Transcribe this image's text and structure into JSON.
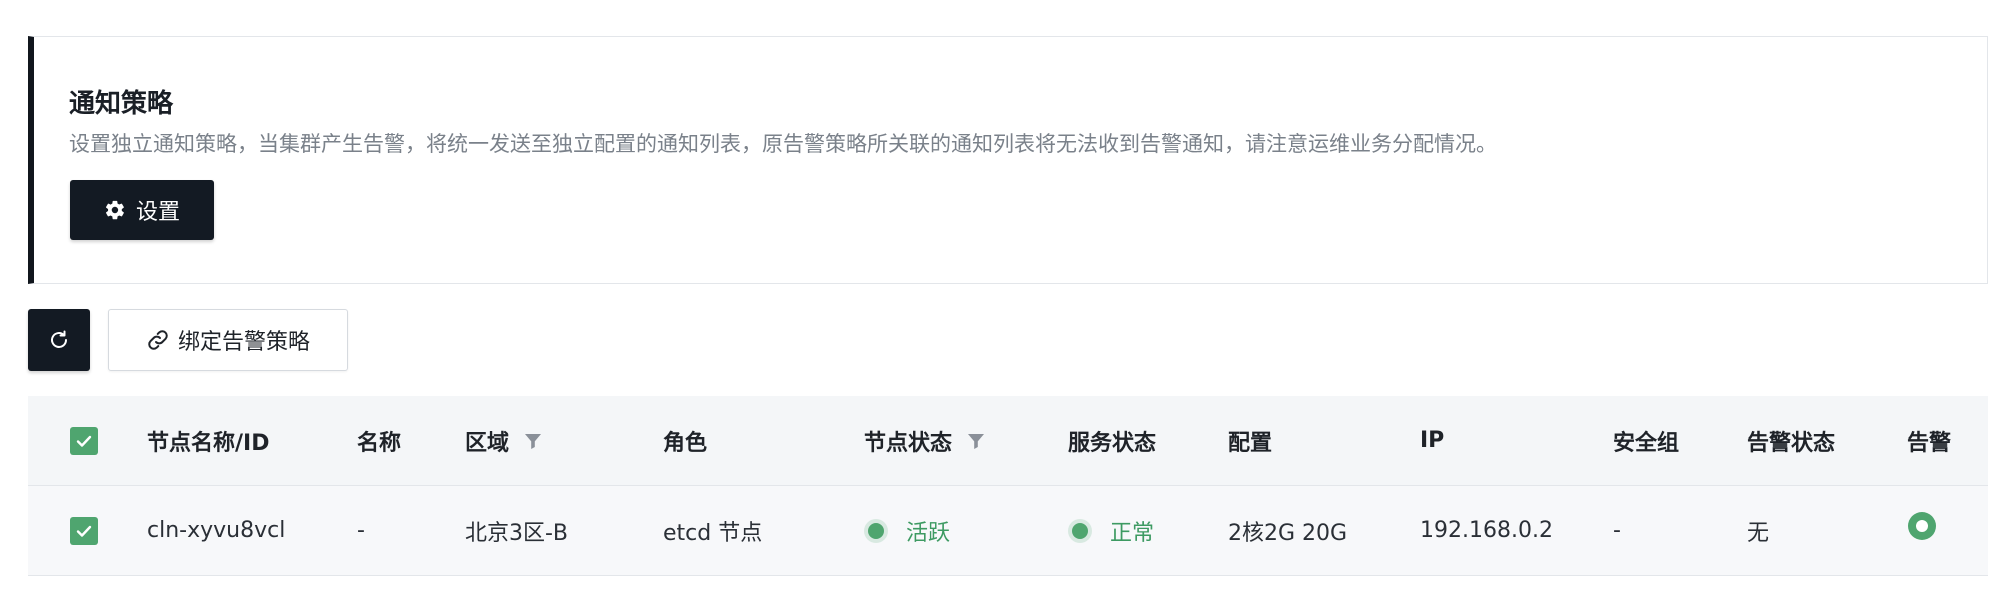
{
  "notice": {
    "title": "通知策略",
    "description": "设置独立通知策略，当集群产生告警，将统一发送至独立配置的通知列表，原告警策略所关联的通知列表将无法收到告警通知，请注意运维业务分配情况。",
    "settings_label": "设置"
  },
  "toolbar": {
    "bind_label": "绑定告警策略"
  },
  "table": {
    "headers": {
      "node_name": "节点名称/ID",
      "name": "名称",
      "zone": "区域",
      "role": "角色",
      "node_status": "节点状态",
      "service_status": "服务状态",
      "config": "配置",
      "ip": "IP",
      "security_group": "安全组",
      "alert_status": "告警状态",
      "alert": "告警"
    },
    "rows": [
      {
        "node_name": "cln-xyvu8vcl",
        "name": "-",
        "zone": "北京3区-B",
        "role": "etcd 节点",
        "node_status": "活跃",
        "service_status": "正常",
        "config": "2核2G 20G",
        "ip": "192.168.0.2",
        "security_group": "-",
        "alert_status": "无"
      }
    ]
  },
  "colors": {
    "primary_dark": "#131a23",
    "success": "#4fa56f",
    "muted_text": "#7a818a"
  }
}
